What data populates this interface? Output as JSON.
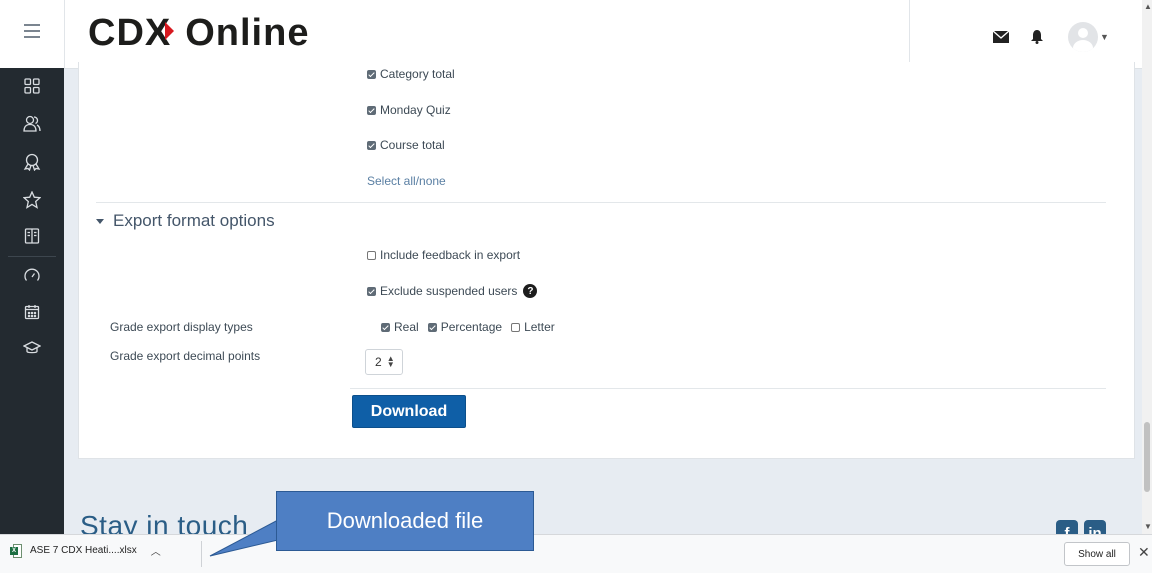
{
  "header": {
    "logo_main": "CDX",
    "logo_second": "Online"
  },
  "sidebar": {
    "items": [
      {
        "icon": "dashboard-grid-icon"
      },
      {
        "icon": "participants-icon"
      },
      {
        "icon": "badges-icon"
      },
      {
        "icon": "competencies-star-icon"
      },
      {
        "icon": "grades-book-icon"
      },
      {
        "icon": "dashboard-gauge-icon"
      },
      {
        "icon": "calendar-icon"
      },
      {
        "icon": "my-courses-cap-icon"
      }
    ]
  },
  "grade_items": [
    {
      "label": "Category total",
      "checked": true
    },
    {
      "label": "Monday Quiz",
      "checked": true
    },
    {
      "label": "Course total",
      "checked": true
    }
  ],
  "select_all_link": "Select all/none",
  "export_format": {
    "section_title": "Export format options",
    "include_feedback": {
      "label": "Include feedback in export",
      "checked": false
    },
    "exclude_suspended": {
      "label": "Exclude suspended users",
      "checked": true
    },
    "help_glyph": "?",
    "display_types_label": "Grade export display types",
    "display_types": [
      {
        "label": "Real",
        "checked": true
      },
      {
        "label": "Percentage",
        "checked": true
      },
      {
        "label": "Letter",
        "checked": false
      }
    ],
    "decimal_points_label": "Grade export decimal points",
    "decimal_points_value": "2",
    "download_label": "Download"
  },
  "footer": {
    "stay_in_touch": "Stay in touch",
    "social": [
      "facebook-icon",
      "linkedin-icon"
    ]
  },
  "download_bar": {
    "file_name": "ASE 7 CDX Heati....xlsx",
    "show_all": "Show all",
    "close_glyph": "✕"
  },
  "annotation": {
    "text": "Downloaded file"
  },
  "colors": {
    "primary_button": "#0f5fa7",
    "sidebar": "#232a30",
    "callout": "#4e7fc4",
    "link": "#5a7fa3"
  }
}
